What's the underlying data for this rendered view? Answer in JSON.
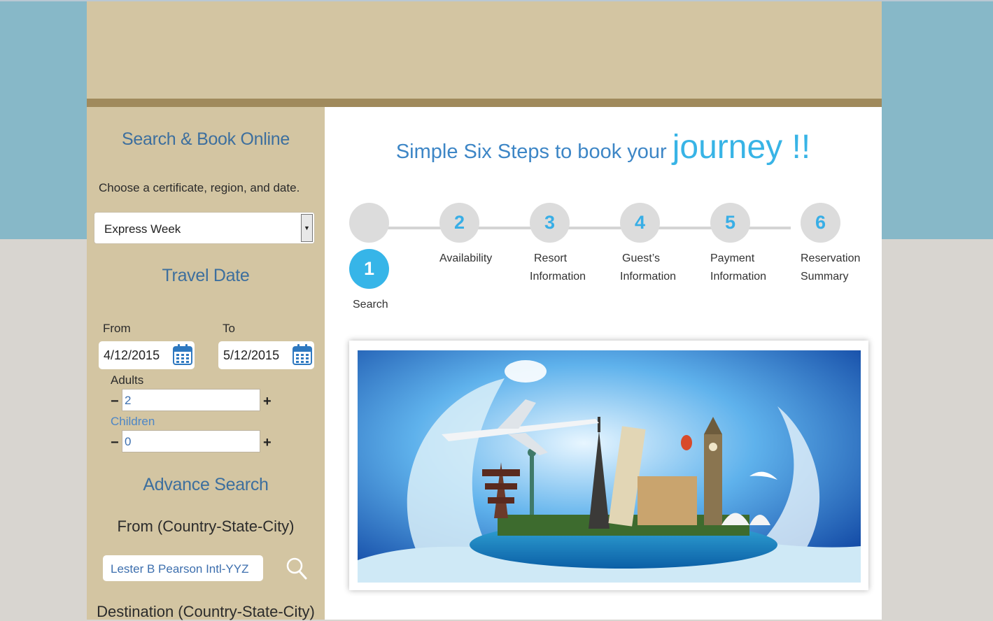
{
  "sidebar": {
    "title": "Search & Book Online",
    "instruction": "Choose a certificate, region, and date.",
    "certificate_select": "Express Week",
    "travel_date_title": "Travel Date",
    "from_label": "From",
    "to_label": "To",
    "from_date": "4/12/2015",
    "to_date": "5/12/2015",
    "adults_label": "Adults",
    "adults_value": "2",
    "children_label": "Children",
    "children_value": "0",
    "minus": "−",
    "plus": "+",
    "advance_search_title": "Advance Search",
    "origin_label": "From (Country-State-City)",
    "origin_value": "Lester B Pearson Intl-YYZ",
    "destination_label": "Destination (Country-State-City)"
  },
  "main": {
    "heading": "Simple Six Steps to book your",
    "heading_emphasis": "journey !!",
    "steps": [
      {
        "number": "1",
        "line1": "Search",
        "line2": ""
      },
      {
        "number": "2",
        "line1": "Availability",
        "line2": ""
      },
      {
        "number": "3",
        "line1": "Resort",
        "line2": "Information"
      },
      {
        "number": "4",
        "line1": "Guest’s",
        "line2": "Information"
      },
      {
        "number": "5",
        "line1": "Payment",
        "line2": "Information"
      },
      {
        "number": "6",
        "line1": "Reservation",
        "line2": "Summary"
      }
    ],
    "active_step": 1
  },
  "colors": {
    "sky_band": "#87b8c8",
    "panel_tan": "#d3c5a2",
    "header_rule": "#a08a5c",
    "title_blue": "#3d6f9e",
    "step_active": "#36b5e8",
    "step_inactive": "#dcdcdc"
  },
  "icons": [
    "calendar-icon",
    "search-icon",
    "dropdown-arrow-icon"
  ]
}
